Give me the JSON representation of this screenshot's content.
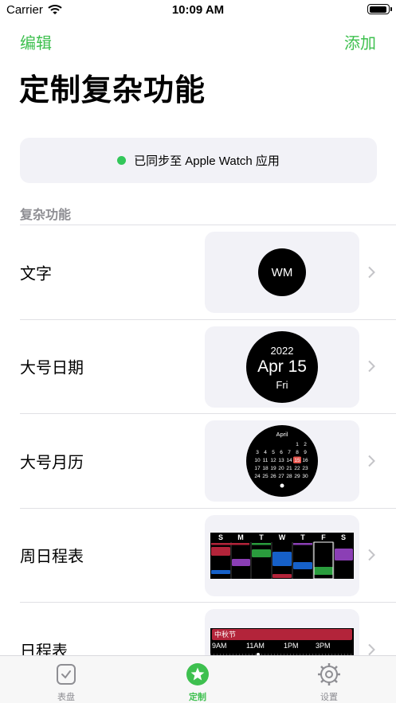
{
  "status_bar": {
    "carrier": "Carrier",
    "time": "10:09 AM"
  },
  "nav": {
    "edit_label": "编辑",
    "add_label": "添加",
    "title": "定制复杂功能"
  },
  "sync": {
    "text": "已同步至 Apple Watch 应用",
    "dot_color": "#33c75a"
  },
  "section": {
    "header": "复杂功能"
  },
  "complications": [
    {
      "label": "文字",
      "preview": {
        "text": "WM"
      }
    },
    {
      "label": "大号日期",
      "preview": {
        "year": "2022",
        "date": "Apr 15",
        "weekday": "Fri"
      }
    },
    {
      "label": "大号月历",
      "preview": {
        "month": "April",
        "week1": [
          "1",
          "2"
        ],
        "week2": [
          "3",
          "4",
          "5",
          "6",
          "7",
          "8",
          "9"
        ],
        "week3": [
          "10",
          "11",
          "12",
          "13",
          "14",
          "15",
          "16"
        ],
        "week4": [
          "17",
          "18",
          "19",
          "20",
          "21",
          "22",
          "23"
        ],
        "week5": [
          "24",
          "25",
          "26",
          "27",
          "28",
          "29",
          "30"
        ],
        "today": "15"
      }
    },
    {
      "label": "周日程表",
      "preview": {
        "days": [
          "S",
          "M",
          "T",
          "W",
          "T",
          "F",
          "S"
        ]
      }
    },
    {
      "label": "日程表",
      "preview": {
        "holiday": "中秋节",
        "hours": [
          "9AM",
          "11AM",
          "1PM",
          "3PM"
        ]
      }
    }
  ],
  "tabs": [
    {
      "label": "表盘",
      "icon": "watch-face-icon",
      "active": false
    },
    {
      "label": "定制",
      "icon": "star-icon",
      "active": true
    },
    {
      "label": "设置",
      "icon": "gear-icon",
      "active": false
    }
  ],
  "colors": {
    "accent": "#3ec04f",
    "today": "#e5534b",
    "event_red": "#b3243a",
    "event_green": "#2a9c3d",
    "event_blue": "#1660c8",
    "event_purple": "#8b3fb5"
  }
}
